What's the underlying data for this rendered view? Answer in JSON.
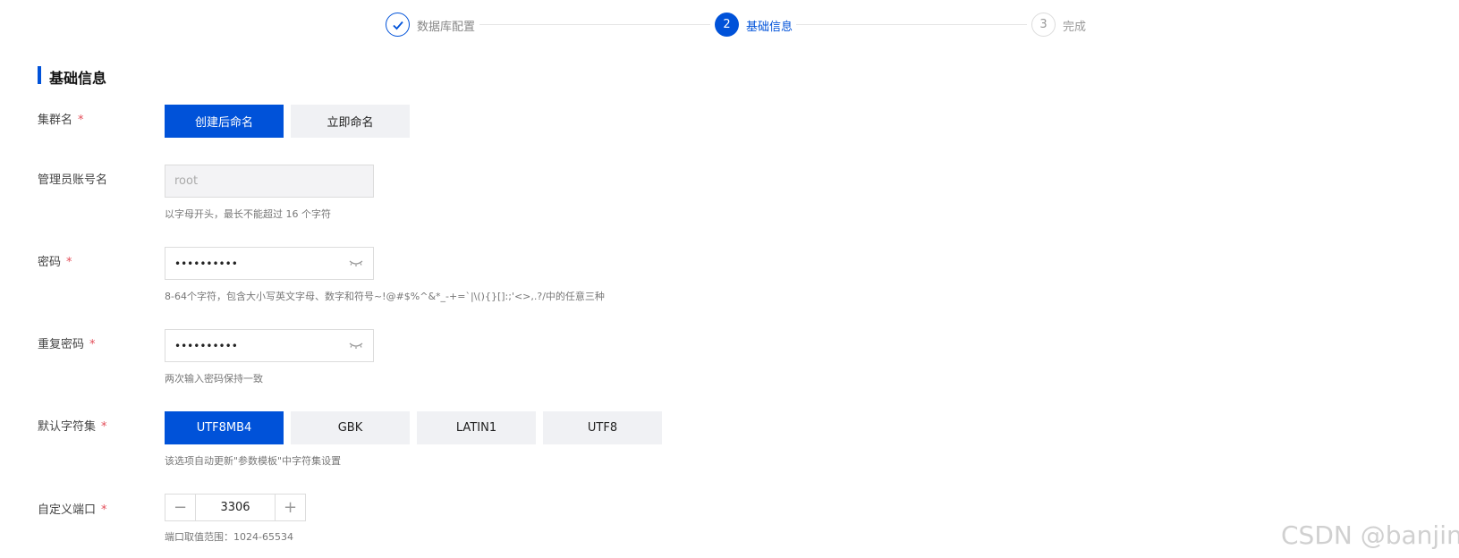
{
  "steps": [
    {
      "number": "1",
      "label": "数据库配置",
      "status": "done"
    },
    {
      "number": "2",
      "label": "基础信息",
      "status": "active"
    },
    {
      "number": "3",
      "label": "完成",
      "status": "todo"
    }
  ],
  "section": {
    "title": "基础信息"
  },
  "form": {
    "cluster_name": {
      "label": "集群名",
      "required_mark": "*",
      "options": [
        "创建后命名",
        "立即命名"
      ],
      "selected": "创建后命名"
    },
    "admin_account": {
      "label": "管理员账号名",
      "placeholder": "root",
      "hint": "以字母开头，最长不能超过 16 个字符"
    },
    "password": {
      "label": "密码",
      "required_mark": "*",
      "value": "••••••••••",
      "hint": "8-64个字符，包含大小写英文字母、数字和符号~!@#$%^&*_-+=`|\\(){}[]:;'<>,.?/中的任意三种"
    },
    "repeat_password": {
      "label": "重复密码",
      "required_mark": "*",
      "value": "••••••••••",
      "hint": "两次输入密码保持一致"
    },
    "charset": {
      "label": "默认字符集",
      "required_mark": "*",
      "options": [
        "UTF8MB4",
        "GBK",
        "LATIN1",
        "UTF8"
      ],
      "selected": "UTF8MB4",
      "hint": "该选项自动更新\"参数模板\"中字符集设置"
    },
    "port": {
      "label": "自定义端口",
      "required_mark": "*",
      "value": "3306",
      "minus": "−",
      "plus": "+",
      "hint": "端口取值范围：1024-65534"
    }
  },
  "watermark": "CSDN @banjin",
  "colors": {
    "primary": "#0052d9",
    "required": "#e34d59"
  },
  "icons": {
    "step1": "check-icon",
    "password_toggle": "eye-closed-icon"
  }
}
